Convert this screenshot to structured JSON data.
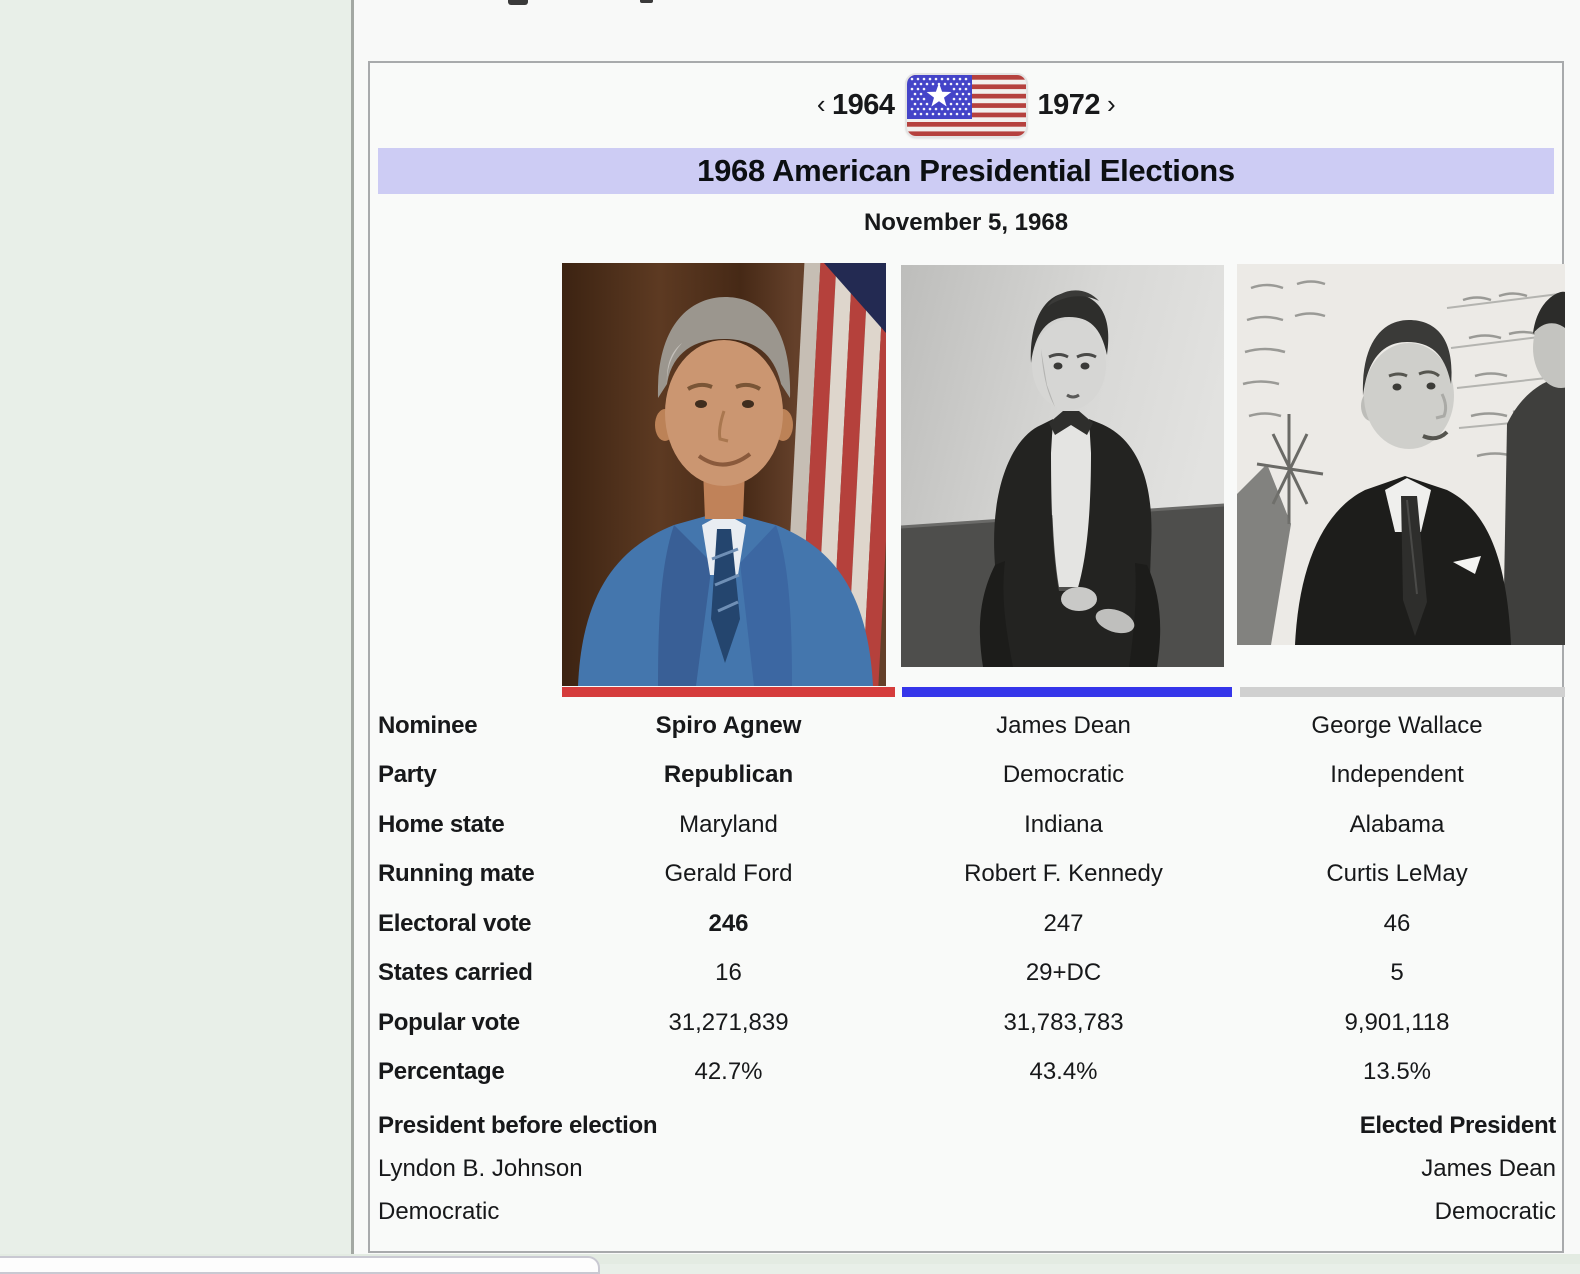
{
  "nav": {
    "prev_arrow": "‹",
    "prev": "1964",
    "next": "1972",
    "next_arrow": "›"
  },
  "icons": {
    "flag": "us-flag-icon",
    "prev": "chevron-left-icon",
    "next": "chevron-right-icon"
  },
  "header": {
    "title": "1968 American Presidential Elections",
    "date": "November 5, 1968"
  },
  "colors": {
    "header_bg": "#cdccf4",
    "republican_bar": "#d53c3c",
    "democratic_bar": "#3535ea",
    "independent_bar": "#d0d0d0"
  },
  "row_labels": {
    "nominee": "Nominee",
    "party": "Party",
    "home_state": "Home state",
    "running_mate": "Running mate",
    "electoral_vote": "Electoral vote",
    "states_carried": "States carried",
    "popular_vote": "Popular vote",
    "percentage": "Percentage"
  },
  "candidates": [
    {
      "name": "Spiro Agnew",
      "party": "Republican",
      "home_state": "Maryland",
      "running_mate": "Gerald Ford",
      "electoral_vote": "246",
      "states_carried": "16",
      "popular_vote": "31,271,839",
      "percentage": "42.7%",
      "photo": "spiro-agnew-portrait"
    },
    {
      "name": "James Dean",
      "party": "Democratic",
      "home_state": "Indiana",
      "running_mate": "Robert F. Kennedy",
      "electoral_vote": "247",
      "states_carried": "29+DC",
      "popular_vote": "31,783,783",
      "percentage": "43.4%",
      "photo": "james-dean-portrait"
    },
    {
      "name": "George Wallace",
      "party": "Independent",
      "home_state": "Alabama",
      "running_mate": "Curtis LeMay",
      "electoral_vote": "46",
      "states_carried": "5",
      "popular_vote": "9,901,118",
      "percentage": "13.5%",
      "photo": "george-wallace-portrait"
    }
  ],
  "footer": {
    "before_label": "President before election",
    "elected_label": "Elected President",
    "before_name": "Lyndon B. Johnson",
    "before_party": "Democratic",
    "elected_name": "James Dean",
    "elected_party": "Democratic"
  }
}
